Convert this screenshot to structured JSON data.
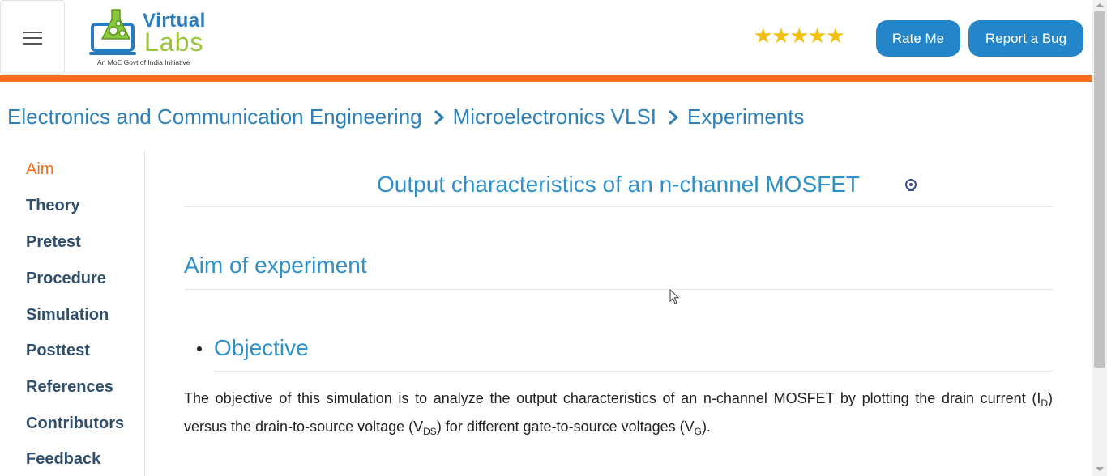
{
  "header": {
    "menu_icon": "hamburger-icon",
    "logo": {
      "word1": "Virtual",
      "word2": "Labs",
      "tagline": "An MoE Govt of India Initiative"
    },
    "rating": {
      "stars": "★★★★★",
      "value": 5,
      "max": 5
    },
    "rate_button": "Rate Me",
    "bug_button": "Report a Bug",
    "accent": "#f36e22",
    "button_color": "#2486c8"
  },
  "breadcrumb": {
    "items": [
      "Electronics and Communication Engineering",
      "Microelectronics VLSI",
      "Experiments"
    ],
    "separator_icon": "chevron-right-icon"
  },
  "sidebar": {
    "items": [
      {
        "label": "Aim",
        "active": true
      },
      {
        "label": "Theory"
      },
      {
        "label": "Pretest"
      },
      {
        "label": "Procedure"
      },
      {
        "label": "Simulation"
      },
      {
        "label": "Posttest"
      },
      {
        "label": "References"
      },
      {
        "label": "Contributors"
      },
      {
        "label": "Feedback"
      }
    ]
  },
  "content": {
    "title": "Output characteristics of an n-channel MOSFET",
    "title_icon": "institute-emblem-icon",
    "aim_heading": "Aim of experiment",
    "objective_heading": "Objective",
    "objective_text": {
      "part1": "The objective of this simulation is to analyze the output characteristics of an n-channel MOSFET by plotting the drain current (I",
      "sub1": "D",
      "part2": ") versus the drain-to-source voltage (V",
      "sub2": "DS",
      "part3": ") for different gate-to-source voltages (V",
      "sub3": "G",
      "part4": ")."
    }
  }
}
